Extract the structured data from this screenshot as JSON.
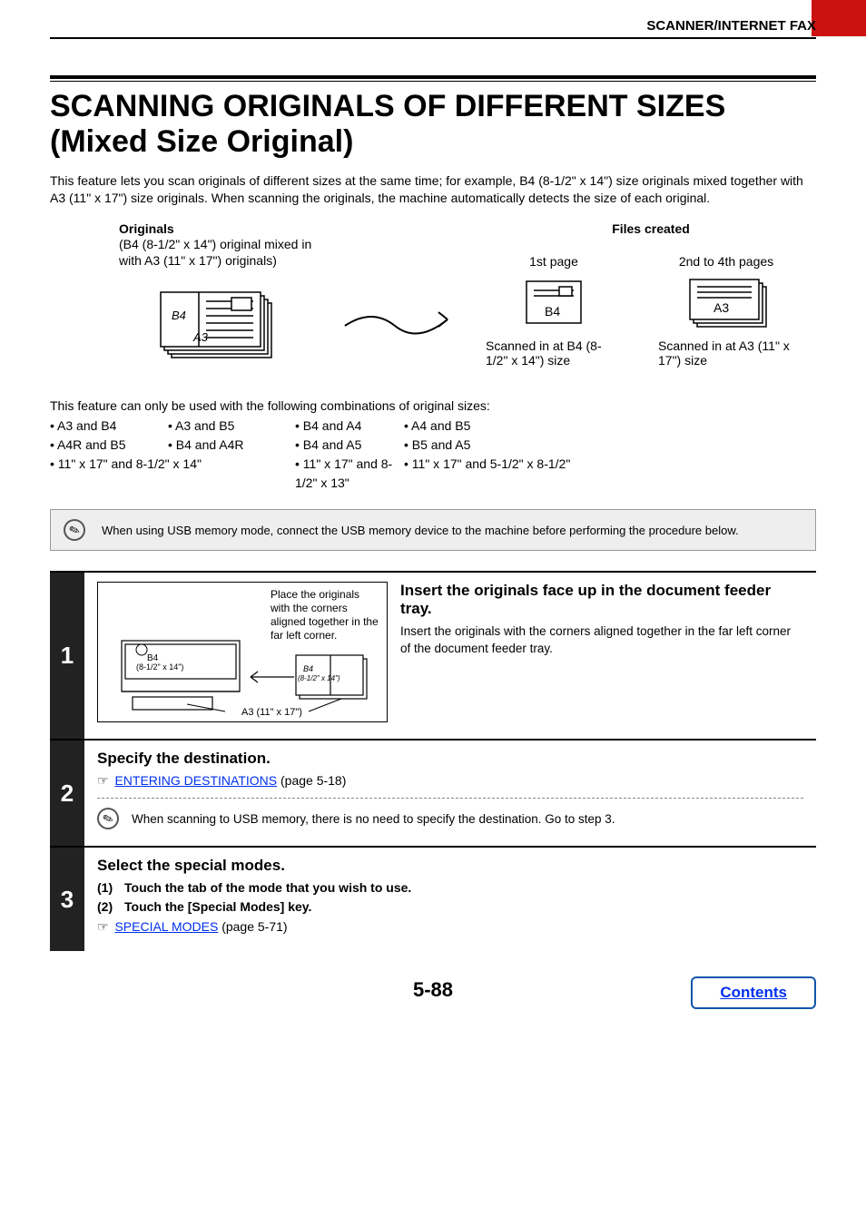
{
  "header": {
    "section": "SCANNER/INTERNET FAX"
  },
  "title": "SCANNING ORIGINALS OF DIFFERENT SIZES (Mixed Size Original)",
  "intro": "This feature lets you scan originals of different sizes at the same time; for example, B4 (8-1/2\" x 14\") size originals mixed together with A3 (11\" x 17\") size originals. When scanning the originals, the machine automatically detects the size of each original.",
  "diagram": {
    "originals_title": "Originals",
    "originals_sub": "(B4 (8-1/2\" x 14\") original mixed in with A3 (11\" x 17\") originals)",
    "stack_labels": {
      "b4": "B4",
      "a3": "A3"
    },
    "files_title": "Files created",
    "col1": {
      "pages": "1st page",
      "label": "B4",
      "caption": "Scanned in at B4 (8-1/2\" x 14\") size"
    },
    "col2": {
      "pages": "2nd to 4th pages",
      "label": "A3",
      "caption": "Scanned in at A3 (11\" x 17\") size"
    }
  },
  "combinations": {
    "intro": "This feature can only be used with the following combinations of original sizes:",
    "row1": [
      "• A3 and B4",
      "• A3 and B5",
      "• B4 and A4",
      "• A4 and B5"
    ],
    "row2": [
      "• A4R and B5",
      "• B4 and A4R",
      "• B4 and A5",
      "• B5 and A5"
    ],
    "row3": [
      "• 11\" x 17\" and 8-1/2\" x 14\"",
      "",
      "• 11\" x 17\" and 8-1/2\" x 13\"",
      "• 11\" x 17\" and 5-1/2\" x 8-1/2\""
    ]
  },
  "usb_note": "When using USB memory mode, connect the USB memory device to the machine before performing the procedure below.",
  "steps": {
    "s1": {
      "num": "1",
      "illu_caption": "Place the originals with the corners aligned together in the far left corner.",
      "illu_b4": "B4\n(8-1/2\" x 14\")",
      "illu_b4_small": "B4\n(8-1/2\" x 14\")",
      "illu_a3": "A3 (11\" x 17\")",
      "heading": "Insert the originals face up in the document feeder tray.",
      "text": "Insert the originals with the corners aligned together in the far left corner of the document feeder tray."
    },
    "s2": {
      "num": "2",
      "heading": "Specify the destination.",
      "link_text": "ENTERING DESTINATIONS",
      "link_page": " (page 5-18)",
      "note": "When scanning to USB memory, there is no need to specify the destination. Go to step 3."
    },
    "s3": {
      "num": "3",
      "heading": "Select the special modes.",
      "li1_n": "(1)",
      "li1": "Touch the tab of the mode that you wish to use.",
      "li2_n": "(2)",
      "li2": "Touch the [Special Modes] key.",
      "link_text": "SPECIAL MODES",
      "link_page": " (page 5-71)"
    }
  },
  "page_number": "5-88",
  "contents_button": "Contents"
}
